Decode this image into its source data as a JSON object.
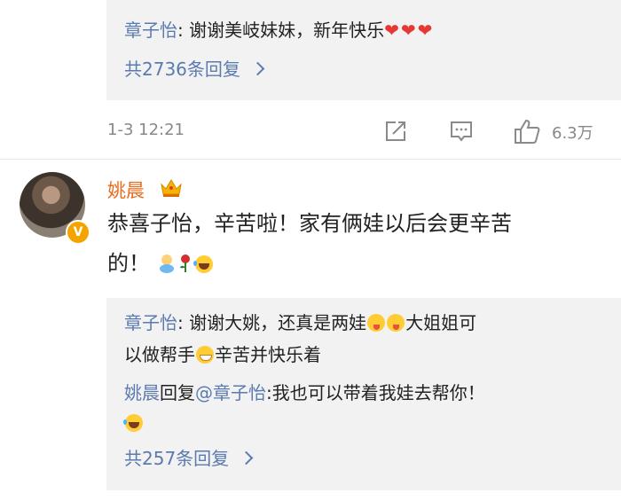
{
  "reply_thread_1": {
    "reply_user": "章子怡",
    "reply_text": ": 谢谢美岐妹妹，新年快乐",
    "hearts": "❤❤❤",
    "reply_count": "共2736条回复"
  },
  "comment_meta": {
    "time": "1-3 12:21",
    "like_count": "6.3万",
    "icons": [
      "share-icon",
      "comment-icon",
      "like-icon"
    ]
  },
  "comment": {
    "user": "姚晨",
    "badge": "V",
    "text_line1": "恭喜子怡，辛苦啦！家有俩娃以后会更辛苦",
    "text_line2": "的！",
    "emojis": [
      "baby",
      "rose",
      "laugh-cry"
    ]
  },
  "reply_thread_2": {
    "reply1_user": "章子怡",
    "reply1_text_a": ": 谢谢大姚，还真是两娃",
    "reply1_text_b": "大姐姐可",
    "reply1_line2_a": "以做帮手",
    "reply1_line2_b": "辛苦并快乐着",
    "reply2_user": "姚晨",
    "reply2_mid": "回复",
    "reply2_mention": "@章子怡",
    "reply2_text": ":我也可以带着我娃去帮你！",
    "reply_count": "共257条回复"
  },
  "colors": {
    "link_blue": "#5b7bb0",
    "vip_orange": "#e86c1e",
    "reply_bg": "#f2f2f2",
    "verified_badge": "#f5a300"
  }
}
